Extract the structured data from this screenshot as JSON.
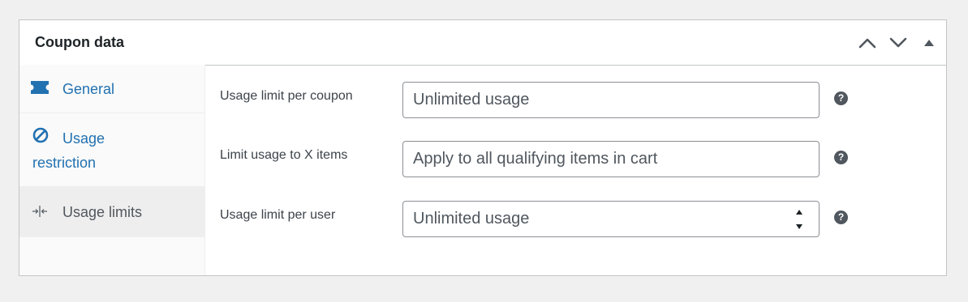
{
  "header": {
    "title": "Coupon data",
    "move_up_icon": "chevron-up",
    "move_down_icon": "chevron-down",
    "toggle_icon": "triangle-up"
  },
  "tabs": [
    {
      "label": "General",
      "icon": "ticket-icon",
      "active": false
    },
    {
      "label_line1": "Usage",
      "label_line2": "restriction",
      "icon": "block-icon",
      "active": false
    },
    {
      "label": "Usage limits",
      "icon": "arrows-in-icon",
      "active": true
    }
  ],
  "fields": {
    "usage_limit_per_coupon": {
      "label": "Usage limit per coupon",
      "placeholder": "Unlimited usage",
      "value": ""
    },
    "limit_usage_to_x_items": {
      "label": "Limit usage to X items",
      "placeholder": "Apply to all qualifying items in cart",
      "value": ""
    },
    "usage_limit_per_user": {
      "label": "Usage limit per user",
      "placeholder": "Unlimited usage",
      "value": ""
    }
  },
  "help_tip": "?",
  "colors": {
    "link": "#2271b1",
    "active_tab_bg": "#eeeeee",
    "border": "#c3c4c7",
    "page_bg": "#f0f0f1"
  }
}
